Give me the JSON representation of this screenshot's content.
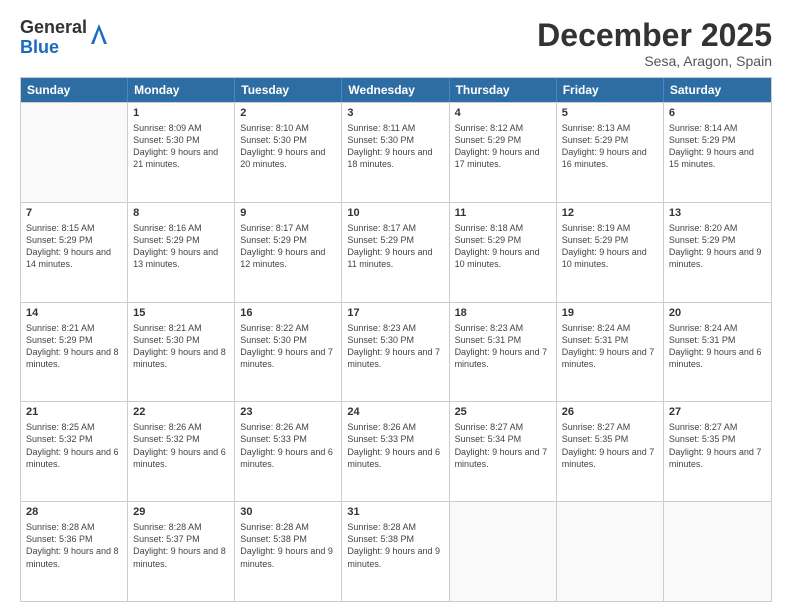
{
  "logo": {
    "general": "General",
    "blue": "Blue"
  },
  "title": "December 2025",
  "subtitle": "Sesa, Aragon, Spain",
  "days": [
    "Sunday",
    "Monday",
    "Tuesday",
    "Wednesday",
    "Thursday",
    "Friday",
    "Saturday"
  ],
  "weeks": [
    [
      {
        "day": "",
        "sunrise": "",
        "sunset": "",
        "daylight": "",
        "empty": true
      },
      {
        "day": "1",
        "sunrise": "Sunrise: 8:09 AM",
        "sunset": "Sunset: 5:30 PM",
        "daylight": "Daylight: 9 hours and 21 minutes."
      },
      {
        "day": "2",
        "sunrise": "Sunrise: 8:10 AM",
        "sunset": "Sunset: 5:30 PM",
        "daylight": "Daylight: 9 hours and 20 minutes."
      },
      {
        "day": "3",
        "sunrise": "Sunrise: 8:11 AM",
        "sunset": "Sunset: 5:30 PM",
        "daylight": "Daylight: 9 hours and 18 minutes."
      },
      {
        "day": "4",
        "sunrise": "Sunrise: 8:12 AM",
        "sunset": "Sunset: 5:29 PM",
        "daylight": "Daylight: 9 hours and 17 minutes."
      },
      {
        "day": "5",
        "sunrise": "Sunrise: 8:13 AM",
        "sunset": "Sunset: 5:29 PM",
        "daylight": "Daylight: 9 hours and 16 minutes."
      },
      {
        "day": "6",
        "sunrise": "Sunrise: 8:14 AM",
        "sunset": "Sunset: 5:29 PM",
        "daylight": "Daylight: 9 hours and 15 minutes."
      }
    ],
    [
      {
        "day": "7",
        "sunrise": "Sunrise: 8:15 AM",
        "sunset": "Sunset: 5:29 PM",
        "daylight": "Daylight: 9 hours and 14 minutes."
      },
      {
        "day": "8",
        "sunrise": "Sunrise: 8:16 AM",
        "sunset": "Sunset: 5:29 PM",
        "daylight": "Daylight: 9 hours and 13 minutes."
      },
      {
        "day": "9",
        "sunrise": "Sunrise: 8:17 AM",
        "sunset": "Sunset: 5:29 PM",
        "daylight": "Daylight: 9 hours and 12 minutes."
      },
      {
        "day": "10",
        "sunrise": "Sunrise: 8:17 AM",
        "sunset": "Sunset: 5:29 PM",
        "daylight": "Daylight: 9 hours and 11 minutes."
      },
      {
        "day": "11",
        "sunrise": "Sunrise: 8:18 AM",
        "sunset": "Sunset: 5:29 PM",
        "daylight": "Daylight: 9 hours and 10 minutes."
      },
      {
        "day": "12",
        "sunrise": "Sunrise: 8:19 AM",
        "sunset": "Sunset: 5:29 PM",
        "daylight": "Daylight: 9 hours and 10 minutes."
      },
      {
        "day": "13",
        "sunrise": "Sunrise: 8:20 AM",
        "sunset": "Sunset: 5:29 PM",
        "daylight": "Daylight: 9 hours and 9 minutes."
      }
    ],
    [
      {
        "day": "14",
        "sunrise": "Sunrise: 8:21 AM",
        "sunset": "Sunset: 5:29 PM",
        "daylight": "Daylight: 9 hours and 8 minutes."
      },
      {
        "day": "15",
        "sunrise": "Sunrise: 8:21 AM",
        "sunset": "Sunset: 5:30 PM",
        "daylight": "Daylight: 9 hours and 8 minutes."
      },
      {
        "day": "16",
        "sunrise": "Sunrise: 8:22 AM",
        "sunset": "Sunset: 5:30 PM",
        "daylight": "Daylight: 9 hours and 7 minutes."
      },
      {
        "day": "17",
        "sunrise": "Sunrise: 8:23 AM",
        "sunset": "Sunset: 5:30 PM",
        "daylight": "Daylight: 9 hours and 7 minutes."
      },
      {
        "day": "18",
        "sunrise": "Sunrise: 8:23 AM",
        "sunset": "Sunset: 5:31 PM",
        "daylight": "Daylight: 9 hours and 7 minutes."
      },
      {
        "day": "19",
        "sunrise": "Sunrise: 8:24 AM",
        "sunset": "Sunset: 5:31 PM",
        "daylight": "Daylight: 9 hours and 7 minutes."
      },
      {
        "day": "20",
        "sunrise": "Sunrise: 8:24 AM",
        "sunset": "Sunset: 5:31 PM",
        "daylight": "Daylight: 9 hours and 6 minutes."
      }
    ],
    [
      {
        "day": "21",
        "sunrise": "Sunrise: 8:25 AM",
        "sunset": "Sunset: 5:32 PM",
        "daylight": "Daylight: 9 hours and 6 minutes."
      },
      {
        "day": "22",
        "sunrise": "Sunrise: 8:26 AM",
        "sunset": "Sunset: 5:32 PM",
        "daylight": "Daylight: 9 hours and 6 minutes."
      },
      {
        "day": "23",
        "sunrise": "Sunrise: 8:26 AM",
        "sunset": "Sunset: 5:33 PM",
        "daylight": "Daylight: 9 hours and 6 minutes."
      },
      {
        "day": "24",
        "sunrise": "Sunrise: 8:26 AM",
        "sunset": "Sunset: 5:33 PM",
        "daylight": "Daylight: 9 hours and 6 minutes."
      },
      {
        "day": "25",
        "sunrise": "Sunrise: 8:27 AM",
        "sunset": "Sunset: 5:34 PM",
        "daylight": "Daylight: 9 hours and 7 minutes."
      },
      {
        "day": "26",
        "sunrise": "Sunrise: 8:27 AM",
        "sunset": "Sunset: 5:35 PM",
        "daylight": "Daylight: 9 hours and 7 minutes."
      },
      {
        "day": "27",
        "sunrise": "Sunrise: 8:27 AM",
        "sunset": "Sunset: 5:35 PM",
        "daylight": "Daylight: 9 hours and 7 minutes."
      }
    ],
    [
      {
        "day": "28",
        "sunrise": "Sunrise: 8:28 AM",
        "sunset": "Sunset: 5:36 PM",
        "daylight": "Daylight: 9 hours and 8 minutes."
      },
      {
        "day": "29",
        "sunrise": "Sunrise: 8:28 AM",
        "sunset": "Sunset: 5:37 PM",
        "daylight": "Daylight: 9 hours and 8 minutes."
      },
      {
        "day": "30",
        "sunrise": "Sunrise: 8:28 AM",
        "sunset": "Sunset: 5:38 PM",
        "daylight": "Daylight: 9 hours and 9 minutes."
      },
      {
        "day": "31",
        "sunrise": "Sunrise: 8:28 AM",
        "sunset": "Sunset: 5:38 PM",
        "daylight": "Daylight: 9 hours and 9 minutes."
      },
      {
        "day": "",
        "sunrise": "",
        "sunset": "",
        "daylight": "",
        "empty": true
      },
      {
        "day": "",
        "sunrise": "",
        "sunset": "",
        "daylight": "",
        "empty": true
      },
      {
        "day": "",
        "sunrise": "",
        "sunset": "",
        "daylight": "",
        "empty": true
      }
    ]
  ]
}
